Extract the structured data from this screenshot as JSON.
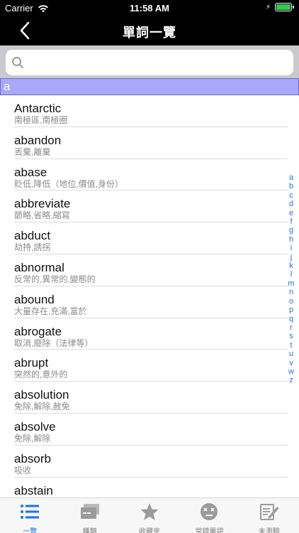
{
  "status": {
    "carrier": "Carrier",
    "time": "11:58 AM",
    "battery_level": 1.0
  },
  "nav": {
    "title": "單詞一覽"
  },
  "search": {
    "placeholder": ""
  },
  "section": "a",
  "words": [
    {
      "word": "Antarctic",
      "meaning": "南極區,南極圈"
    },
    {
      "word": "abandon",
      "meaning": "丟棄,離棄"
    },
    {
      "word": "abase",
      "meaning": "貶低,降低（地位,價值,身份）"
    },
    {
      "word": "abbreviate",
      "meaning": "節略,省略,縮寫"
    },
    {
      "word": "abduct",
      "meaning": "劫持,誘拐"
    },
    {
      "word": "abnormal",
      "meaning": "反常的,異常的,變態的"
    },
    {
      "word": "abound",
      "meaning": "大量存在,充滿,富於"
    },
    {
      "word": "abrogate",
      "meaning": "取消,廢除（法律等）"
    },
    {
      "word": "abrupt",
      "meaning": "突然的,意外的"
    },
    {
      "word": "absolution",
      "meaning": "免除,解除,赦免"
    },
    {
      "word": "absolve",
      "meaning": "免除,解除"
    },
    {
      "word": "absorb",
      "meaning": "吸收"
    },
    {
      "word": "abstain",
      "meaning": ""
    }
  ],
  "index_letters": [
    "a",
    "b",
    "c",
    "d",
    "e",
    "f",
    "g",
    "h",
    "i",
    "j",
    "k",
    "l",
    "m",
    "n",
    "o",
    "p",
    "q",
    "r",
    "s",
    "t",
    "u",
    "v",
    "w",
    "z"
  ],
  "tabs": [
    {
      "label": "一覽",
      "icon": "list-icon",
      "active": true
    },
    {
      "label": "種類",
      "icon": "cards-icon",
      "active": false
    },
    {
      "label": "收藏夾",
      "icon": "star-icon",
      "active": false
    },
    {
      "label": "常錯單詞",
      "icon": "dizzy-face-icon",
      "active": false
    },
    {
      "label": "未測驗",
      "icon": "edit-icon",
      "active": false
    }
  ],
  "colors": {
    "accent": "#1a73e8",
    "section_bg": "#a9a7f7",
    "battery": "#35c759",
    "nav_bg": "#000000"
  }
}
